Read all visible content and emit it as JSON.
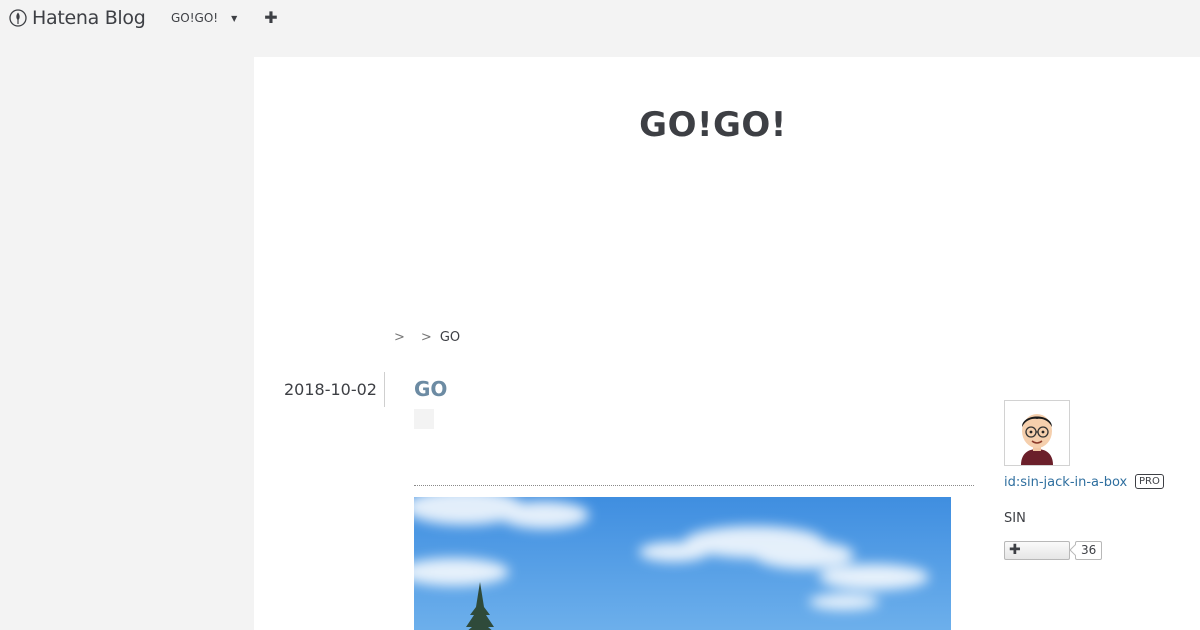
{
  "global_header": {
    "logo_text": "Hatena Blog",
    "blog_menu_label": "GO!GO!",
    "blog_menu_icon": "caret-down-icon",
    "add_icon": "plus-icon"
  },
  "blog": {
    "title": "GO!GO!"
  },
  "breadcrumb": {
    "separator": ">",
    "current": "GO"
  },
  "entry": {
    "date": "2018-10-02",
    "title": "GO",
    "photo_icon": "landscape-photo"
  },
  "profile": {
    "id_label": "id:sin-jack-in-a-box",
    "badge": "PRO",
    "name": "SIN",
    "subscribe_icon": "plus-icon",
    "subscribe_count": "36"
  },
  "colors": {
    "background": "#f3f3f3",
    "content": "#ffffff",
    "text": "#3d3f44",
    "entry_title": "#6c8ba3",
    "link": "#2f6f9f"
  }
}
